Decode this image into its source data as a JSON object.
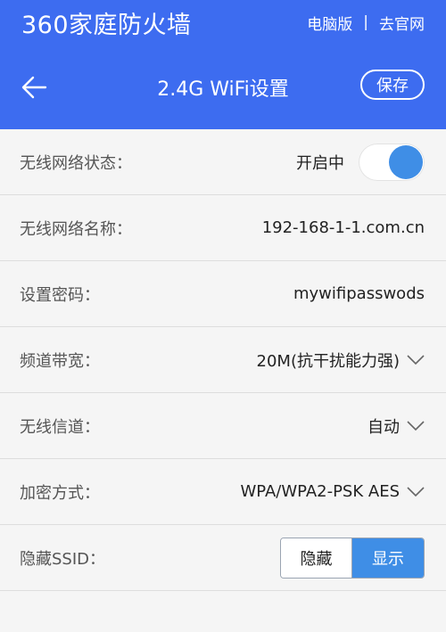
{
  "topbar": {
    "brand": "360家庭防火墙",
    "link_pc": "电脑版",
    "separator": "|",
    "link_official": "去官网"
  },
  "header": {
    "title": "2.4G WiFi设置",
    "save_label": "保存"
  },
  "rows": {
    "status": {
      "label": "无线网络状态：",
      "value": "开启中"
    },
    "ssid": {
      "label": "无线网络名称：",
      "value": "192-168-1-1.com.cn"
    },
    "password": {
      "label": "设置密码：",
      "value": "mywifipasswods"
    },
    "bandwidth": {
      "label": "频道带宽：",
      "value": "20M(抗干扰能力强)"
    },
    "channel": {
      "label": "无线信道：",
      "value": "自动"
    },
    "encryption": {
      "label": "加密方式：",
      "value": "WPA/WPA2-PSK AES"
    },
    "hide_ssid": {
      "label": "隐藏SSID：",
      "option_hide": "隐藏",
      "option_show": "显示",
      "selected": "显示"
    }
  },
  "colors": {
    "header_bg": "#3d6cf0",
    "accent": "#3f8ee6",
    "page_bg": "#f5f5f5"
  },
  "icons": {
    "back": "arrow-left-icon",
    "dropdown": "chevron-down-icon"
  }
}
